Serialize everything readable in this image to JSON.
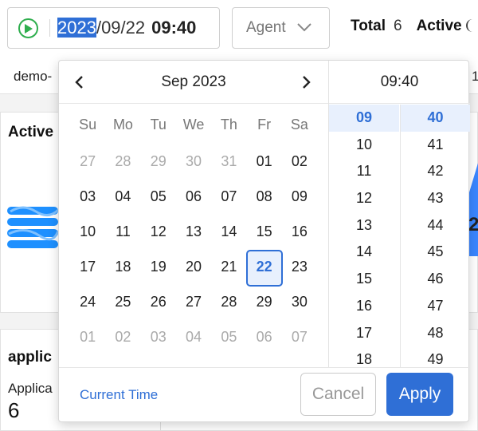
{
  "header": {
    "datetime": {
      "year": "2023",
      "rest_date": "/09/22",
      "time": "09:40"
    },
    "agent_select": {
      "label": "Agent"
    },
    "stats": [
      {
        "label": "Total",
        "value": "6"
      },
      {
        "label": "Active",
        "value": ""
      }
    ]
  },
  "subbar": {
    "left_text": "demo-",
    "right_text": "1"
  },
  "cards": {
    "active": {
      "title": "Active"
    },
    "application": {
      "title": "applic",
      "subtitle": "Applica",
      "value": "6"
    },
    "right_digit": "2"
  },
  "calendar": {
    "month_label": "Sep 2023",
    "weekdays": [
      "Su",
      "Mo",
      "Tu",
      "We",
      "Th",
      "Fr",
      "Sa"
    ],
    "days": [
      {
        "d": "27",
        "muted": true
      },
      {
        "d": "28",
        "muted": true
      },
      {
        "d": "29",
        "muted": true
      },
      {
        "d": "30",
        "muted": true
      },
      {
        "d": "31",
        "muted": true
      },
      {
        "d": "01"
      },
      {
        "d": "02"
      },
      {
        "d": "03"
      },
      {
        "d": "04"
      },
      {
        "d": "05"
      },
      {
        "d": "06"
      },
      {
        "d": "07"
      },
      {
        "d": "08"
      },
      {
        "d": "09"
      },
      {
        "d": "10"
      },
      {
        "d": "11"
      },
      {
        "d": "12"
      },
      {
        "d": "13"
      },
      {
        "d": "14"
      },
      {
        "d": "15"
      },
      {
        "d": "16"
      },
      {
        "d": "17"
      },
      {
        "d": "18"
      },
      {
        "d": "19"
      },
      {
        "d": "20"
      },
      {
        "d": "21"
      },
      {
        "d": "22",
        "selected": true
      },
      {
        "d": "23"
      },
      {
        "d": "24"
      },
      {
        "d": "25"
      },
      {
        "d": "26"
      },
      {
        "d": "27"
      },
      {
        "d": "28"
      },
      {
        "d": "29"
      },
      {
        "d": "30"
      },
      {
        "d": "01",
        "muted": true
      },
      {
        "d": "02",
        "muted": true
      },
      {
        "d": "03",
        "muted": true
      },
      {
        "d": "04",
        "muted": true
      },
      {
        "d": "05",
        "muted": true
      },
      {
        "d": "06",
        "muted": true
      },
      {
        "d": "07",
        "muted": true
      }
    ]
  },
  "time_picker": {
    "header": "09:40",
    "hours": [
      "09",
      "10",
      "11",
      "12",
      "13",
      "14",
      "15",
      "16",
      "17",
      "18"
    ],
    "minutes": [
      "40",
      "41",
      "42",
      "43",
      "44",
      "45",
      "46",
      "47",
      "48",
      "49"
    ],
    "selected_hour": "09",
    "selected_minute": "40"
  },
  "footer": {
    "current_time_label": "Current Time",
    "cancel_label": "Cancel",
    "apply_label": "Apply"
  },
  "colors": {
    "accent": "#2f6fd6",
    "play": "#2fae4e"
  }
}
